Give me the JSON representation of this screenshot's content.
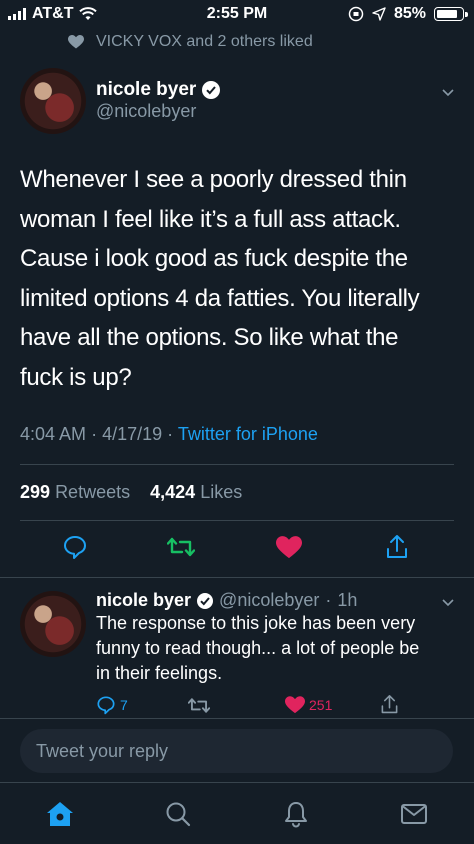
{
  "status_bar": {
    "carrier": "AT&T",
    "time": "2:55 PM",
    "battery": "85%",
    "battery_level": 0.85
  },
  "social_context": {
    "text": "VICKY VOX and 2 others liked",
    "icon": "heart-icon"
  },
  "tweet": {
    "author_name": "nicole byer",
    "author_handle": "@nicolebyer",
    "verified": true,
    "text_lines": [
      "Whenever I see a poorly dressed thin",
      "woman I feel like it’s a full ass attack.",
      "Cause i look good as fuck despite the",
      "limited options 4 da fatties. You literally",
      "have all the options. So like what the",
      "fuck is up?"
    ],
    "time": "4:04 AM",
    "date": "4/17/19",
    "source": "Twitter for iPhone",
    "retweets_count": "299",
    "retweets_label": "Retweets",
    "likes_count": "4,424",
    "likes_label": "Likes"
  },
  "reply": {
    "author_name": "nicole byer",
    "author_handle": "@nicolebyer",
    "time_ago": "1h",
    "text_lines": [
      "The response to this joke has been very",
      "funny to read though... a lot of people be",
      "in their feelings."
    ],
    "reply_count": "7",
    "like_count": "251"
  },
  "compose": {
    "placeholder": "Tweet your reply"
  },
  "colors": {
    "background": "#141d26",
    "accent": "#1da1f2",
    "retweet": "#17bf63",
    "like": "#e0245e",
    "muted": "#8899a6",
    "divider": "#38444d"
  }
}
